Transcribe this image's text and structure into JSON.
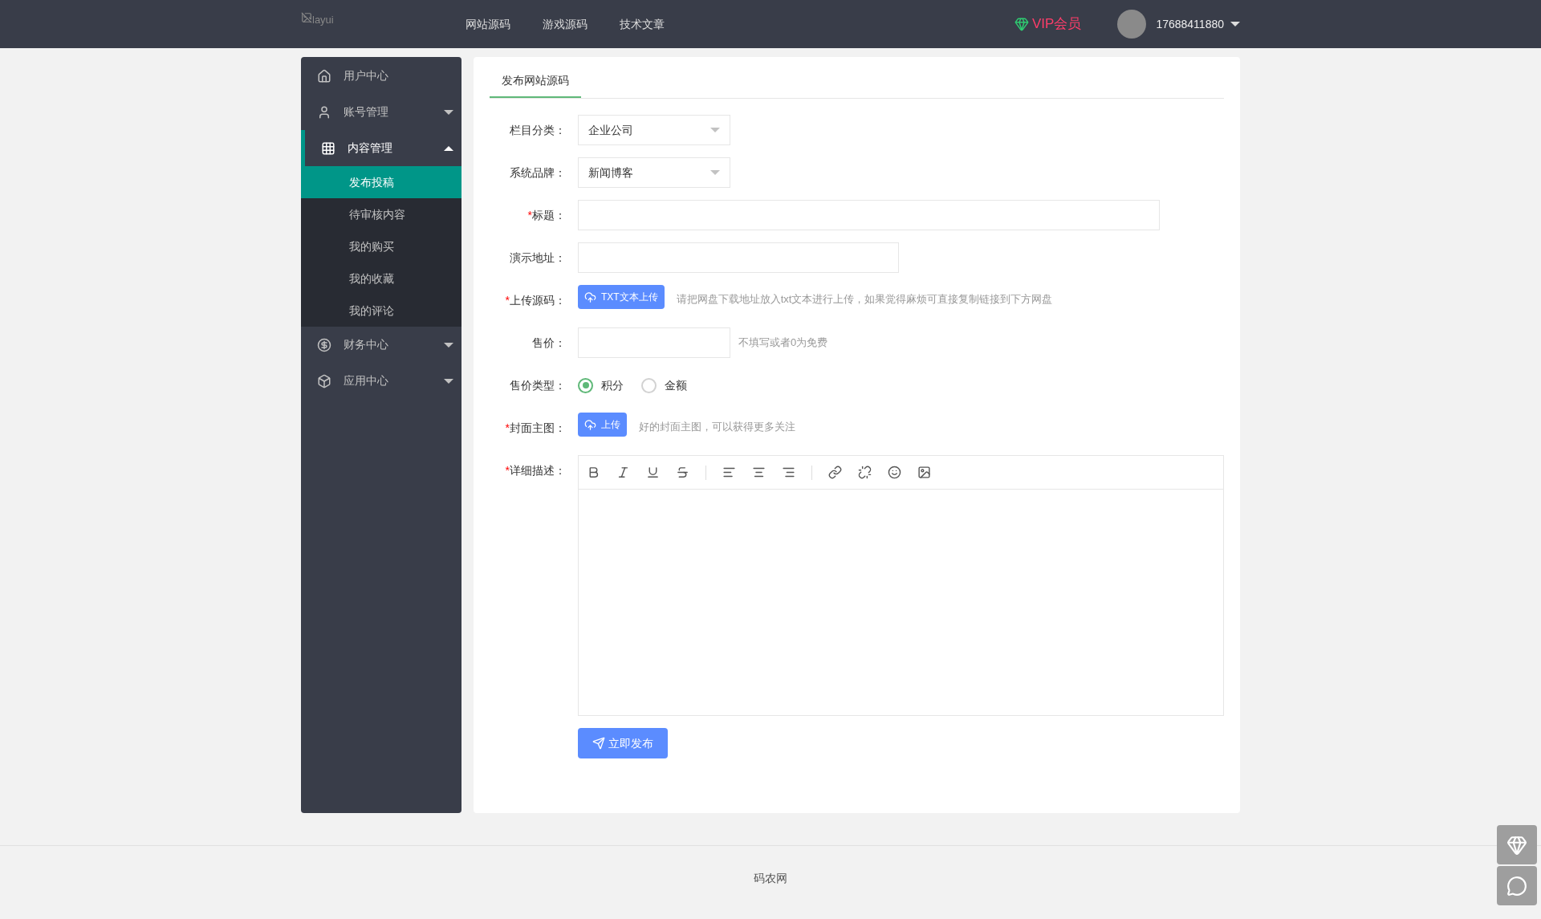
{
  "header": {
    "logo_alt": "layui",
    "nav": [
      "网站源码",
      "游戏源码",
      "技术文章"
    ],
    "vip": "VIP会员",
    "username": "17688411880"
  },
  "sidebar": [
    {
      "label": "用户中心",
      "selected": false
    },
    {
      "label": "账号管理",
      "selected": false,
      "expanded": false
    },
    {
      "label": "内容管理",
      "selected": true,
      "expanded": true,
      "children": [
        {
          "label": "发布投稿",
          "selected": true
        },
        {
          "label": "待审核内容",
          "selected": false
        },
        {
          "label": "我的购买",
          "selected": false
        },
        {
          "label": "我的收藏",
          "selected": false
        },
        {
          "label": "我的评论",
          "selected": false
        }
      ]
    },
    {
      "label": "财务中心",
      "selected": false,
      "expanded": false
    },
    {
      "label": "应用中心",
      "selected": false,
      "expanded": false
    }
  ],
  "tabs": [
    {
      "label": "发布网站源码",
      "selected": true
    }
  ],
  "form": [
    {
      "kind": "select",
      "label": "栏目分类：",
      "value": "企业公司"
    },
    {
      "kind": "select",
      "label": "系统品牌：",
      "value": "新闻博客"
    },
    {
      "kind": "text",
      "mark": "*",
      "label": "标题："
    },
    {
      "kind": "text",
      "label": "演示地址："
    },
    {
      "kind": "upload",
      "mark": "*",
      "label": "上传源码：",
      "button": "TXT文本上传",
      "hint": "请把网盘下载地址放入txt文本进行上传，如果觉得麻烦可直接复制链接到下方网盘"
    },
    {
      "kind": "text",
      "label": "售价：",
      "hint": "不填写或者0为免费"
    },
    {
      "kind": "radio",
      "label": "售价类型：",
      "options": [
        {
          "label": "积分",
          "selected": true
        },
        {
          "label": "金额",
          "selected": false
        }
      ]
    },
    {
      "kind": "upload",
      "mark": "*",
      "label": "封面主图：",
      "button": "上传",
      "hint": "好的封面主图，可以获得更多关注"
    },
    {
      "kind": "editor",
      "mark": "*",
      "label": "详细描述："
    }
  ],
  "submit": "立即发布",
  "footer": "码农网"
}
